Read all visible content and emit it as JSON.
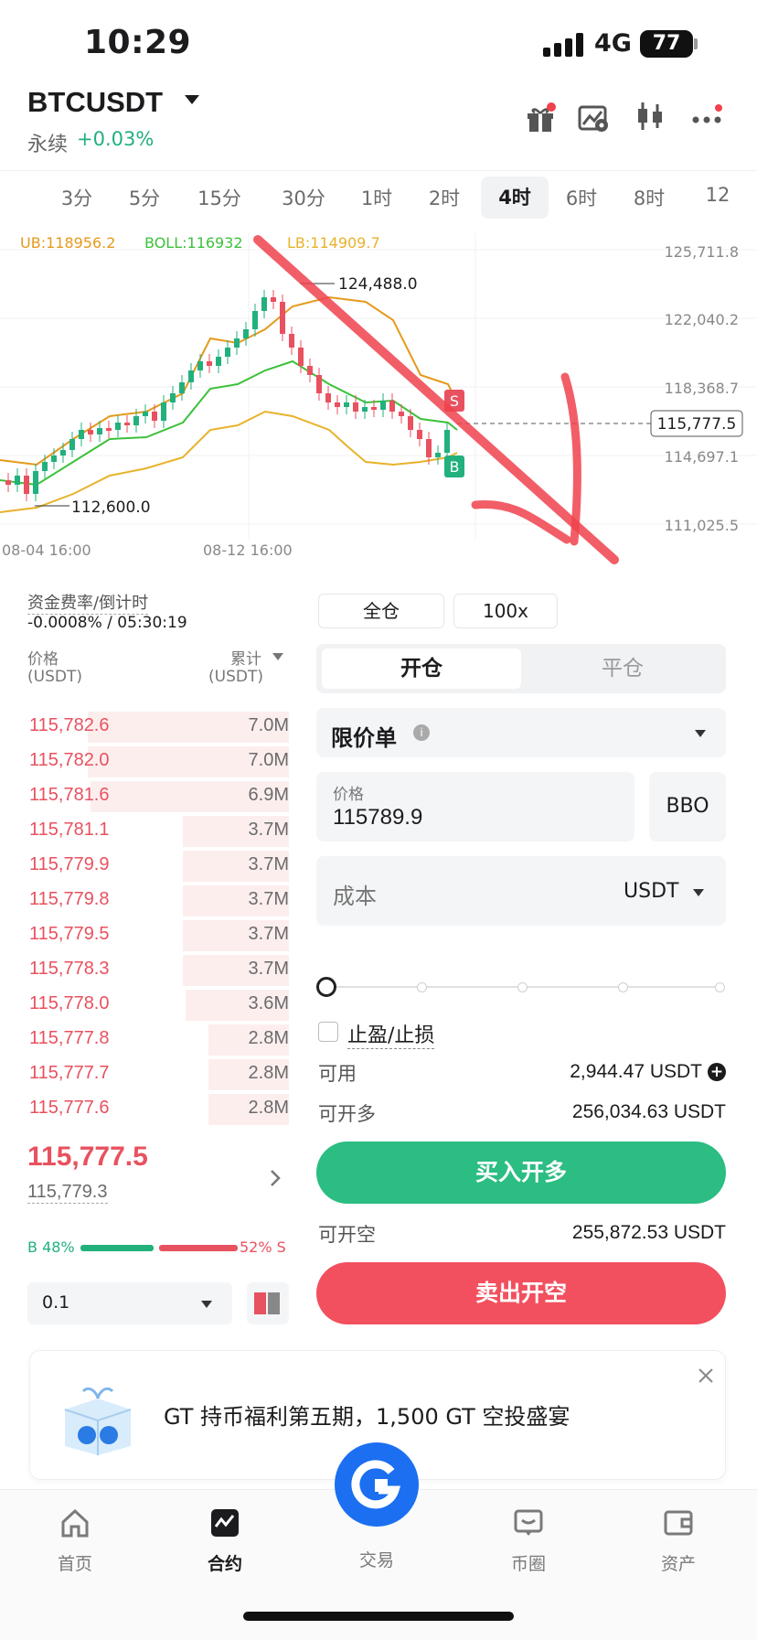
{
  "status": {
    "time": "10:29",
    "network": "4G",
    "battery": "77"
  },
  "header": {
    "symbol": "BTCUSDT",
    "contract_type": "永续",
    "change": "+0.03%"
  },
  "timeframes": [
    "3分",
    "5分",
    "15分",
    "30分",
    "1时",
    "2时",
    "4时",
    "6时",
    "8时",
    "12"
  ],
  "active_timeframe": "4时",
  "chart": {
    "indicators": {
      "ub": "UB:118956.2",
      "boll": "BOLL:116932",
      "lb": "LB:114909.7"
    },
    "y_ticks": [
      "125,711.8",
      "122,040.2",
      "118,368.7",
      "114,697.1",
      "111,025.5"
    ],
    "current_price_tag": "115,777.5",
    "high_label": "124,488.0",
    "low_label": "112,600.0",
    "x_ticks": [
      "08-04 16:00",
      "08-12 16:00"
    ],
    "sell_marker": "S",
    "buy_marker": "B",
    "colors": {
      "up": "#22b07d",
      "down": "#e8515f",
      "ub": "#e59a1c",
      "boll": "#3cc13b",
      "lb": "#e8b22a",
      "annotation": "#f0424c"
    }
  },
  "orderbook": {
    "funding_label": "资金费率/倒计时",
    "funding_value": "-0.0008% / 05:30:19",
    "price_header": "价格",
    "price_unit": "(USDT)",
    "total_header": "累计",
    "total_unit": "(USDT)",
    "asks": [
      {
        "price": "115,782.6",
        "amount": "7.0M"
      },
      {
        "price": "115,782.0",
        "amount": "7.0M"
      },
      {
        "price": "115,781.6",
        "amount": "6.9M"
      },
      {
        "price": "115,781.1",
        "amount": "3.7M"
      },
      {
        "price": "115,779.9",
        "amount": "3.7M"
      },
      {
        "price": "115,779.8",
        "amount": "3.7M"
      },
      {
        "price": "115,779.5",
        "amount": "3.7M"
      },
      {
        "price": "115,778.3",
        "amount": "3.7M"
      },
      {
        "price": "115,778.0",
        "amount": "3.6M"
      },
      {
        "price": "115,777.8",
        "amount": "2.8M"
      },
      {
        "price": "115,777.7",
        "amount": "2.8M"
      },
      {
        "price": "115,777.6",
        "amount": "2.8M"
      }
    ],
    "last_price": "115,777.5",
    "mark_price": "115,779.3",
    "buy_ratio": "B 48%",
    "sell_ratio": "52% S",
    "buy_ratio_fraction": 0.48,
    "qty_step": "0.1"
  },
  "order_form": {
    "margin_mode": "全仓",
    "leverage": "100x",
    "open_tab": "开仓",
    "close_tab": "平仓",
    "order_type": "限价单",
    "price_label": "价格",
    "price_value": "115789.9",
    "bbo": "BBO",
    "cost_placeholder": "成本",
    "cost_unit": "USDT",
    "tpsl_label": "止盈/止损",
    "available_label": "可用",
    "available_value": "2,944.47 USDT",
    "max_long_label": "可开多",
    "max_long_value": "256,034.63 USDT",
    "buy_button": "买入开多",
    "max_short_label": "可开空",
    "max_short_value": "255,872.53 USDT",
    "sell_button": "卖出开空",
    "buy_color": "#2bbd82",
    "sell_color": "#f2505f"
  },
  "promo": {
    "text": "GT 持币福利第五期，1,500 GT 空投盛宴"
  },
  "nav": {
    "items": [
      {
        "label": "首页",
        "icon": "home-icon"
      },
      {
        "label": "合约",
        "icon": "futures-icon"
      },
      {
        "label": "交易",
        "icon": "trade-icon"
      },
      {
        "label": "币圈",
        "icon": "community-icon"
      },
      {
        "label": "资产",
        "icon": "wallet-icon"
      }
    ],
    "active": "合约",
    "accent": "#1b6ff0"
  }
}
